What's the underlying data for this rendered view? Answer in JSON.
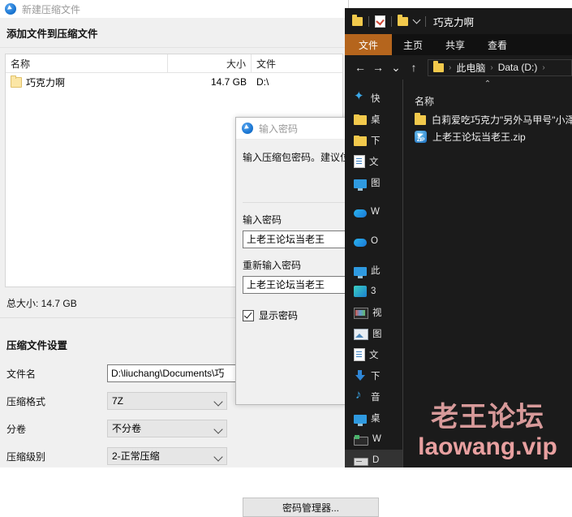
{
  "bandizip": {
    "window_title": "新建压缩文件",
    "section_header": "添加文件到压缩文件",
    "columns": {
      "name": "名称",
      "size": "大小",
      "path": "文件"
    },
    "rows": [
      {
        "name": "巧克力啊",
        "size": "14.7 GB",
        "path": "D:\\"
      }
    ],
    "total_size": "总大小: 14.7 GB",
    "settings_title": "压缩文件设置",
    "fields": [
      {
        "label": "文件名",
        "value": "D:\\liuchang\\Documents\\巧",
        "type": "input"
      },
      {
        "label": "压缩格式",
        "value": "7Z",
        "type": "select"
      },
      {
        "label": "分卷",
        "value": "不分卷",
        "type": "select"
      },
      {
        "label": "压缩级别",
        "value": "2-正常压缩",
        "type": "select"
      }
    ]
  },
  "password_dialog": {
    "title": "输入密码",
    "description": "输入压缩包密码。建议位",
    "password_label": "输入密码",
    "password_value": "上老王论坛当老王",
    "confirm_label": "重新输入密码",
    "confirm_value": "上老王论坛当老王",
    "show_password_label": "显示密码",
    "show_password_checked": true,
    "manager_button": "密码管理器..."
  },
  "explorer": {
    "window_title": "巧克力啊",
    "quick_access_icons": [
      "folder-icon",
      "properties-icon",
      "new-folder-icon",
      "customize-chevron-icon"
    ],
    "ribbon_tabs": [
      {
        "label": "文件",
        "active": true
      },
      {
        "label": "主页",
        "active": false
      },
      {
        "label": "共享",
        "active": false
      },
      {
        "label": "查看",
        "active": false
      }
    ],
    "nav_buttons": [
      "back-icon",
      "forward-icon",
      "recent-locations-icon",
      "up-icon"
    ],
    "breadcrumb": [
      "此电脑",
      "Data (D:)"
    ],
    "sidebar_items": [
      {
        "icon": "star-icon",
        "label": "快"
      },
      {
        "icon": "folder-icon",
        "label": "桌"
      },
      {
        "icon": "folder-icon",
        "label": "下"
      },
      {
        "icon": "document-icon",
        "label": "文"
      },
      {
        "icon": "monitor-icon",
        "label": "图"
      },
      {
        "icon": "onedrive-icon",
        "label": "W"
      },
      {
        "icon": "onedrive-icon",
        "label": "O"
      },
      {
        "icon": "this-pc-icon",
        "label": "此"
      },
      {
        "icon": "cube-icon",
        "label": "3"
      },
      {
        "icon": "film-icon",
        "label": "视"
      },
      {
        "icon": "picture-icon",
        "label": "图"
      },
      {
        "icon": "document-icon",
        "label": "文"
      },
      {
        "icon": "download-icon",
        "label": "下"
      },
      {
        "icon": "music-icon",
        "label": "音"
      },
      {
        "icon": "monitor-icon",
        "label": "桌"
      },
      {
        "icon": "network-drive-icon",
        "label": "W"
      },
      {
        "icon": "drive-icon",
        "label": "D",
        "selected": true
      }
    ],
    "list_column_header": "名称",
    "files": [
      {
        "icon": "folder-icon",
        "name": "白莉爱吃巧克力\"另外马甲号\"小泽"
      },
      {
        "icon": "zip-icon",
        "name": "上老王论坛当老王.zip"
      }
    ]
  },
  "watermark": {
    "line1": "老王论坛",
    "line2": "laowang.vip",
    "color": "#d79a9a"
  }
}
